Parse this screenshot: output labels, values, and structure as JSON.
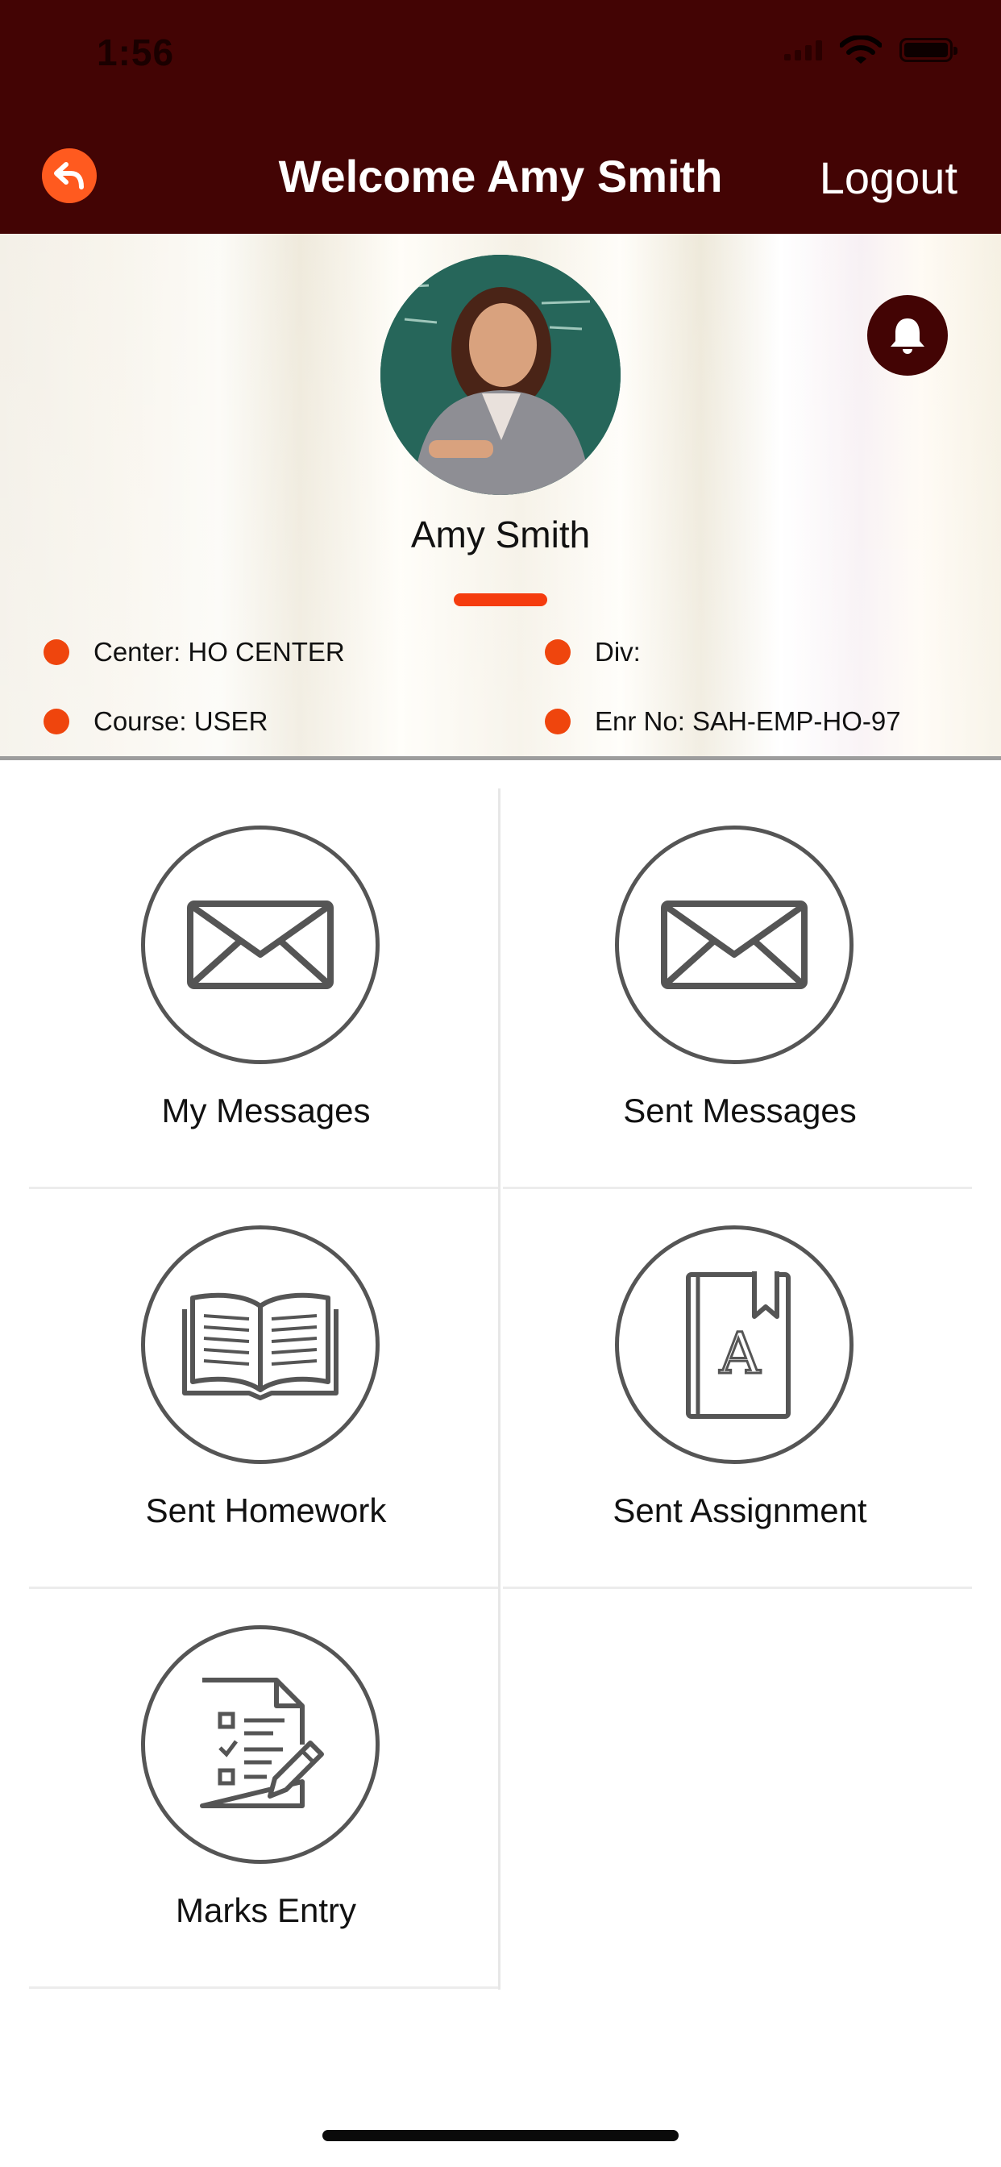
{
  "status_bar": {
    "time": "1:56"
  },
  "header": {
    "title": "Welcome Amy Smith",
    "logout_label": "Logout"
  },
  "profile": {
    "name": "Amy Smith",
    "info": [
      {
        "key": "center",
        "text": "Center: HO CENTER"
      },
      {
        "key": "div",
        "text": "Div:"
      },
      {
        "key": "course",
        "text": "Course: USER"
      },
      {
        "key": "enr_no",
        "text": "Enr No: SAH-EMP-HO-97"
      }
    ]
  },
  "menu": {
    "items": [
      {
        "label": "My Messages",
        "icon": "envelope-icon"
      },
      {
        "label": "Sent Messages",
        "icon": "envelope-icon"
      },
      {
        "label": "Sent Homework",
        "icon": "open-book-icon"
      },
      {
        "label": "Sent Assignment",
        "icon": "bookmarked-book-icon"
      },
      {
        "label": "Marks Entry",
        "icon": "checklist-edit-icon"
      }
    ]
  },
  "colors": {
    "header": "#430404",
    "accent": "#ef450d",
    "back_button": "#ff5a1f",
    "icon_stroke": "#555555"
  }
}
